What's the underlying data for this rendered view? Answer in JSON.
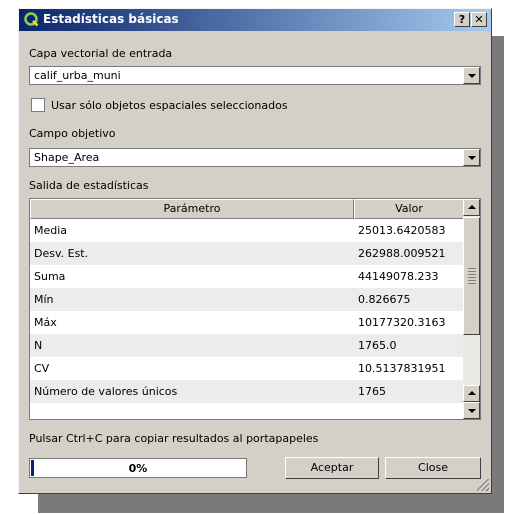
{
  "window": {
    "title": "Estadísticas básicas",
    "help_label": "?",
    "close_label": "✕"
  },
  "input_layer": {
    "label": "Capa vectorial de entrada",
    "value": "calif_urba_muni"
  },
  "selected_only": {
    "label": "Usar sólo objetos espaciales seleccionados",
    "checked": false
  },
  "target_field": {
    "label": "Campo objetivo",
    "value": "Shape_Area"
  },
  "output": {
    "label": "Salida de estadísticas",
    "columns": [
      "Parámetro",
      "Valor"
    ],
    "rows": [
      {
        "param": "Media",
        "value": "25013.6420583"
      },
      {
        "param": "Desv. Est.",
        "value": "262988.009521"
      },
      {
        "param": "Suma",
        "value": "44149078.233"
      },
      {
        "param": "Mín",
        "value": "0.826675"
      },
      {
        "param": "Máx",
        "value": "10177320.3163"
      },
      {
        "param": "N",
        "value": "1765.0"
      },
      {
        "param": "CV",
        "value": "10.5137831951"
      },
      {
        "param": "Número de valores únicos",
        "value": "1765"
      }
    ]
  },
  "hint": "Pulsar Ctrl+C para copiar resultados al portapapeles",
  "progress": {
    "percent": 0,
    "label": "0%"
  },
  "buttons": {
    "accept": "Aceptar",
    "close": "Close"
  },
  "icons": {
    "app": "qgis-icon",
    "dropdown": "chevron-down-icon",
    "scroll_up": "chevron-up-icon",
    "scroll_down": "chevron-down-icon"
  }
}
